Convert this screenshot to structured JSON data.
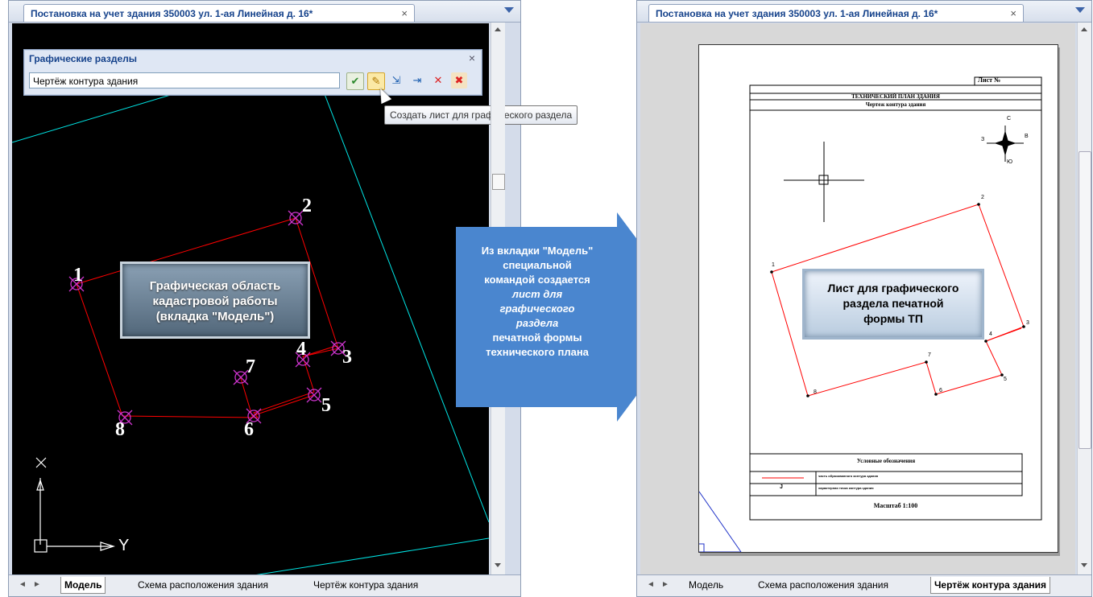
{
  "left_window": {
    "tab_title": "Постановка на учет здания 350003 ул. 1-ая Линейная д. 16*",
    "tab_close": "×",
    "panel": {
      "title": "Графические разделы",
      "close": "×",
      "section_value": "Чертёж контура здания",
      "tooltip": "Создать лист для графического раздела"
    },
    "points": [
      "1",
      "2",
      "3",
      "4",
      "5",
      "6",
      "7",
      "8"
    ],
    "axis": {
      "x": "X",
      "y": "Y"
    },
    "callout": [
      "Графическая область",
      "кадастровой работы",
      "(вкладка \"Модель\")"
    ],
    "sheet_tabs": [
      "Модель",
      "Схема расположения здания",
      "Чертёж контура здания"
    ],
    "active_tab": "Модель"
  },
  "arrow_note": {
    "line1": "Из вкладки \"Модель\"",
    "line2": "специальной",
    "line3": "командой создается",
    "line4_italic": "лист для",
    "line5_italic": "графического",
    "line6_italic": "раздела",
    "line7": "печатной формы",
    "line8": "технического плана"
  },
  "right_window": {
    "tab_title": "Постановка на учет здания 350003 ул. 1-ая Линейная д. 16*",
    "tab_close": "×",
    "sheet": {
      "sheet_no": "Лист №",
      "title": "ТЕХНИЧЕСКИЙ ПЛАН ЗДАНИЯ",
      "subtitle": "Чертеж контура здания",
      "compass": {
        "n": "С",
        "s": "Ю",
        "w": "З",
        "e": "В"
      },
      "points": [
        "1",
        "2",
        "3",
        "4",
        "5",
        "6",
        "7",
        "8"
      ],
      "legend_title": "Условные обозначения",
      "legend_row1": "часть образованного контура здания",
      "legend_row2_symbol": "J",
      "legend_row2": "характерная точка контура здания",
      "scale": "Масштаб 1:100"
    },
    "callout": [
      "Лист для графического",
      "раздела печатной",
      "формы ТП"
    ],
    "sheet_tabs": [
      "Модель",
      "Схема расположения здания",
      "Чертёж контура здания"
    ],
    "active_tab": "Чертёж контура здания"
  },
  "colors": {
    "cad_bg": "#000000",
    "contour": "#ff0000",
    "marker": "#cc33cc",
    "boundary": "#00e5e5",
    "arrow": "#4a86cf",
    "tab_text": "#15428b"
  }
}
